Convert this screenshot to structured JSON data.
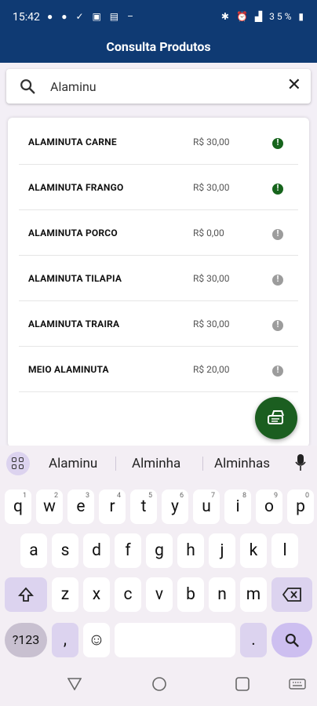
{
  "status_bar": {
    "time": "15:42",
    "battery": "35%"
  },
  "app": {
    "title": "Consulta Produtos"
  },
  "search": {
    "value": "Alaminu"
  },
  "products": [
    {
      "name": "ALAMINUTA CARNE",
      "price": "R$ 30,00",
      "status": "available"
    },
    {
      "name": "ALAMINUTA FRANGO",
      "price": "R$ 30,00",
      "status": "available"
    },
    {
      "name": "ALAMINUTA PORCO",
      "price": "R$ 0,00",
      "status": "unavailable"
    },
    {
      "name": "ALAMINUTA TILAPIA",
      "price": "R$ 30,00",
      "status": "unavailable"
    },
    {
      "name": "ALAMINUTA TRAIRA",
      "price": "R$ 30,00",
      "status": "unavailable"
    },
    {
      "name": "MEIO ALAMINUTA",
      "price": "R$ 20,00",
      "status": "unavailable"
    }
  ],
  "colors": {
    "brand": "#0f3a73",
    "available": "#16641c",
    "unavailable": "#9c9c9c",
    "fab": "#1b5e20"
  },
  "keyboard": {
    "suggestions": [
      "Alaminu",
      "Alminha",
      "Alminhas"
    ],
    "row1": [
      "q",
      "w",
      "e",
      "r",
      "t",
      "y",
      "u",
      "i",
      "o",
      "p"
    ],
    "row1_digits": [
      "1",
      "2",
      "3",
      "4",
      "5",
      "6",
      "7",
      "8",
      "9",
      "0"
    ],
    "row2": [
      "a",
      "s",
      "d",
      "f",
      "g",
      "h",
      "j",
      "k",
      "l"
    ],
    "row3": [
      "z",
      "x",
      "c",
      "v",
      "b",
      "n",
      "m"
    ],
    "symbols_key": "?123",
    "comma_key": ",",
    "period_key": "."
  }
}
